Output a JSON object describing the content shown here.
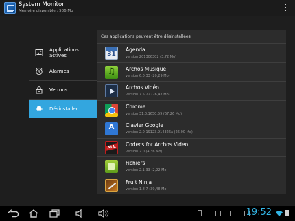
{
  "actionbar": {
    "title": "System Monitor",
    "subtitle": "Mémoire disponible : 506 Mo"
  },
  "menu": {
    "items": [
      {
        "label": "Applications actives",
        "icon": "image-icon",
        "active": false
      },
      {
        "label": "Alarmes",
        "icon": "alarm-icon",
        "active": false
      },
      {
        "label": "Verrous",
        "icon": "lock-icon",
        "active": false
      },
      {
        "label": "Désinstaller",
        "icon": "android-icon",
        "active": true
      }
    ]
  },
  "panel": {
    "header": "Ces applications peuvent être désinstallées",
    "apps": [
      {
        "name": "Agenda",
        "version": "version 201306302 (3,72 Mo)",
        "icon": "calendar-icon"
      },
      {
        "name": "Archos Musique",
        "version": "version 6.0.33 (20,29 Mo)",
        "icon": "music-icon"
      },
      {
        "name": "Archos Vidéo",
        "version": "version 7.5.22 (26,47 Mo)",
        "icon": "video-icon"
      },
      {
        "name": "Chrome",
        "version": "version 31.0.1650.59 (67,26 Mo)",
        "icon": "chrome-icon"
      },
      {
        "name": "Clavier Google",
        "version": "version 2.0.19123.914326a (26,00 Mo)",
        "icon": "keyboard-icon"
      },
      {
        "name": "Codecs for Archos Video",
        "version": "version 2.0 (4,36 Mo)",
        "icon": "codecs-icon"
      },
      {
        "name": "Fichiers",
        "version": "version 2.1.33 (2,22 Mo)",
        "icon": "files-icon"
      },
      {
        "name": "Fruit Ninja",
        "version": "version 1.8.7 (39,48 Mo)",
        "icon": "fruit-ninja-icon"
      }
    ]
  },
  "sysbar": {
    "clock": "19:52"
  },
  "colors": {
    "accent": "#33a6df",
    "clock": "#33b5e5"
  }
}
